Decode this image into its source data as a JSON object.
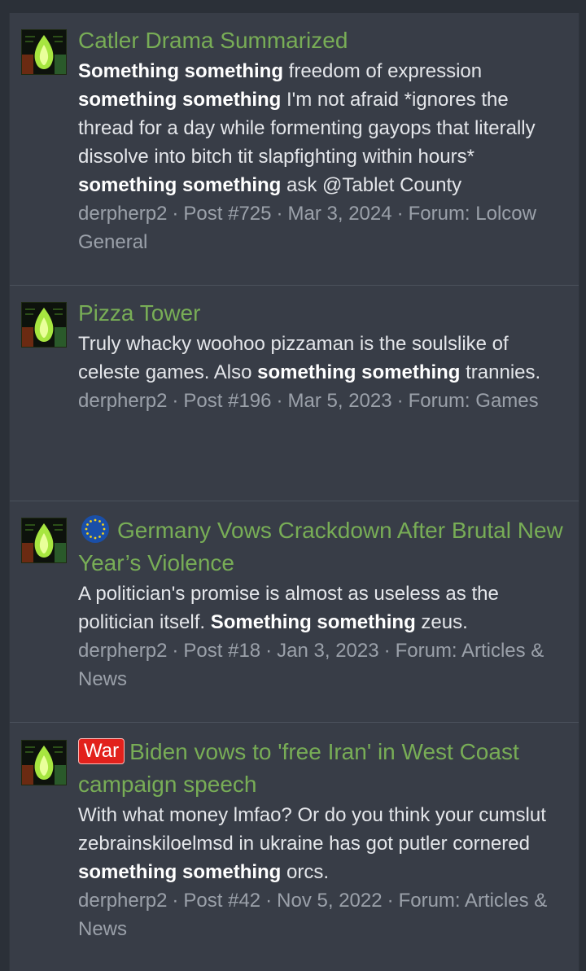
{
  "results": [
    {
      "title": "Catler Drama Summarized",
      "snippet": [
        {
          "text": "Something something",
          "bold": true
        },
        {
          "text": " freedom of expression ",
          "bold": false
        },
        {
          "text": "something something",
          "bold": true
        },
        {
          "text": " I'm not afraid *ignores the thread for a day while formenting gayops that literally dissolve into bitch tit slapfighting within hours* ",
          "bold": false
        },
        {
          "text": "something something",
          "bold": true
        },
        {
          "text": " ask @Tablet County",
          "bold": false
        }
      ],
      "author": "derpherp2",
      "post": "Post #725",
      "date": "Mar 3, 2024",
      "forum": "Forum: Lolcow General"
    },
    {
      "title": "Pizza Tower",
      "snippet": [
        {
          "text": "Truly whacky woohoo pizzaman is the soulslike of celeste games. Also ",
          "bold": false
        },
        {
          "text": "something something",
          "bold": true
        },
        {
          "text": " trannies.",
          "bold": false
        }
      ],
      "author": "derpherp2",
      "post": "Post #196",
      "date": "Mar 5, 2023",
      "forum": "Forum: Games"
    },
    {
      "prefix_icon": "eu-flag-icon",
      "title": "Germany Vows Crackdown After Brutal New Year’s Violence",
      "snippet": [
        {
          "text": "A politician's promise is almost as useless as the politician itself. ",
          "bold": false
        },
        {
          "text": "Something something",
          "bold": true
        },
        {
          "text": " zeus.",
          "bold": false
        }
      ],
      "author": "derpherp2",
      "post": "Post #18",
      "date": "Jan 3, 2023",
      "forum": "Forum: Articles & News"
    },
    {
      "tag": "War",
      "title": "Biden vows to 'free Iran' in West Coast campaign speech",
      "snippet": [
        {
          "text": "With what money lmfao? Or do you think your cumslut zebrainskiloelmsd in ukraine has got putler cornered ",
          "bold": false
        },
        {
          "text": "something something",
          "bold": true
        },
        {
          "text": " orcs.",
          "bold": false
        }
      ],
      "author": "derpherp2",
      "post": "Post #42",
      "date": "Nov 5, 2022",
      "forum": "Forum: Articles & News"
    }
  ],
  "colors": {
    "title_link": "#78ad56",
    "war_tag": "#e2211c",
    "meta_text": "#9ba1aa"
  }
}
